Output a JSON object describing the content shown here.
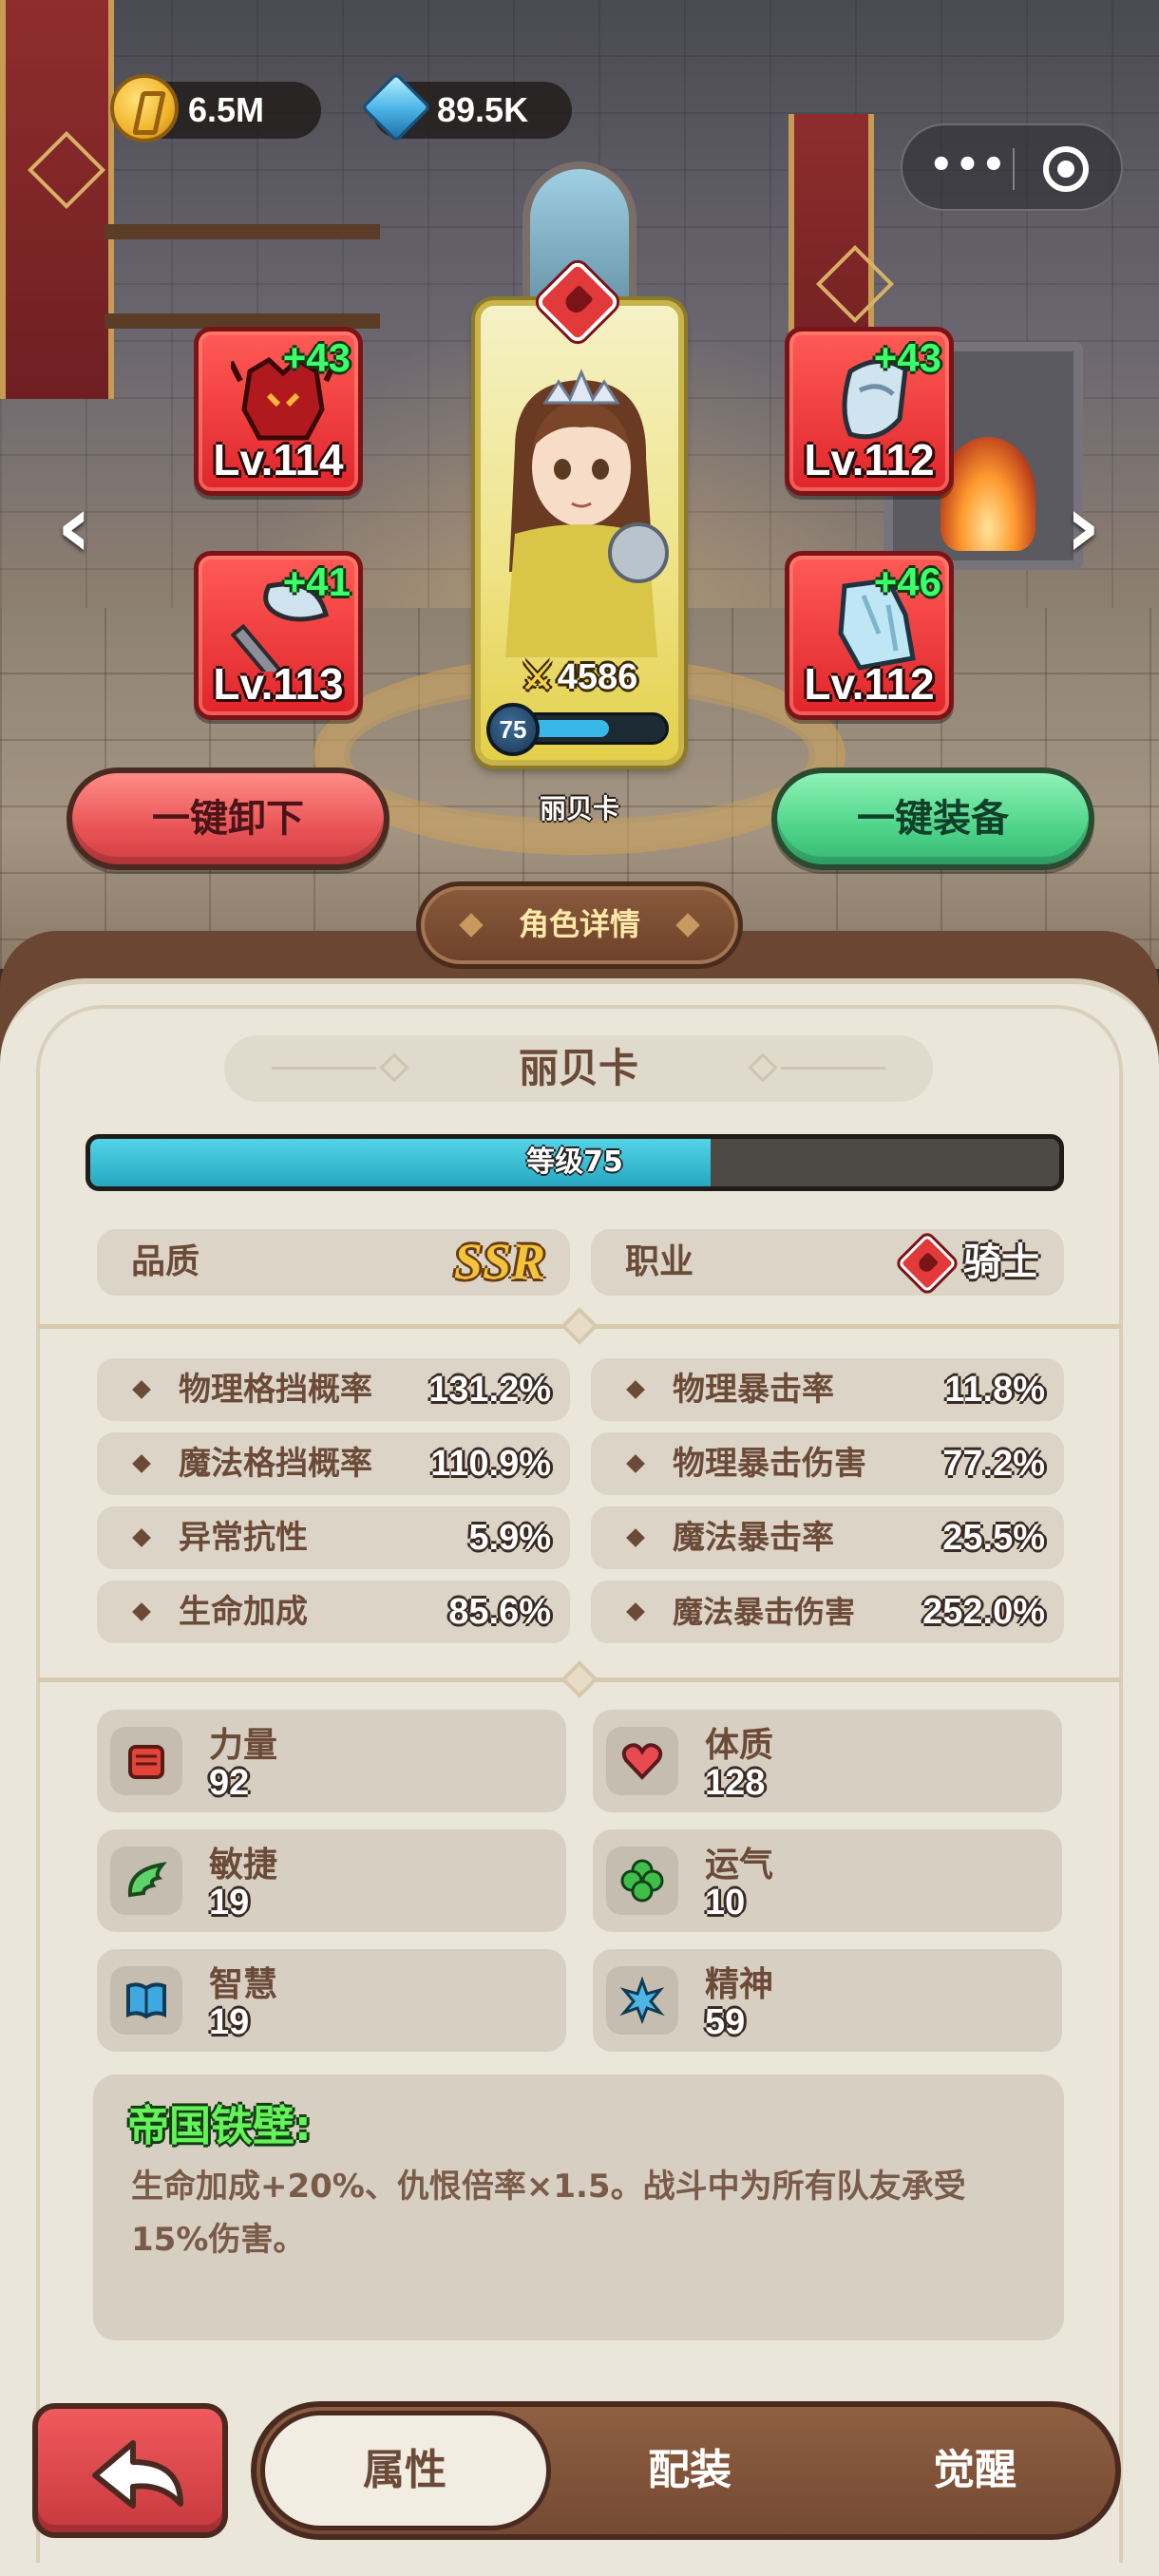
{
  "hud": {
    "gold": "6.5M",
    "gems": "89.5K",
    "gold_icon": "gold-coin-icon",
    "gem_icon": "blue-gem-icon",
    "more_label": "•••"
  },
  "equipment": [
    {
      "slot": "helmet",
      "plus": "+43",
      "level": "Lv.114"
    },
    {
      "slot": "axe",
      "plus": "+41",
      "level": "Lv.113"
    },
    {
      "slot": "armor",
      "plus": "+43",
      "level": "Lv.112"
    },
    {
      "slot": "boots",
      "plus": "+46",
      "level": "Lv.112"
    }
  ],
  "hero_card": {
    "power": "4586",
    "level": "75",
    "xp_fraction": 0.6,
    "name": "丽贝卡"
  },
  "actions": {
    "unequip_all": "一键卸下",
    "equip_all": "一键装备"
  },
  "panel": {
    "title": "角色详情",
    "hero_name": "丽贝卡",
    "level_text": "等级75",
    "level_fraction": 0.64,
    "quality_label": "品质",
    "quality_value": "SSR",
    "class_label": "职业",
    "class_value": "骑士"
  },
  "stats_left": [
    {
      "name": "物理格挡概率",
      "value": "131.2%"
    },
    {
      "name": "魔法格挡概率",
      "value": "110.9%"
    },
    {
      "name": "异常抗性",
      "value": "5.9%"
    },
    {
      "name": "生命加成",
      "value": "85.6%"
    }
  ],
  "stats_right": [
    {
      "name": "物理暴击率",
      "value": "11.8%"
    },
    {
      "name": "物理暴击伤害",
      "value": "77.2%"
    },
    {
      "name": "魔法暴击率",
      "value": "25.5%"
    },
    {
      "name": "魔法暴击伤害",
      "value": "252.0%"
    }
  ],
  "attributes": [
    {
      "name": "力量",
      "value": "92",
      "icon": "fist-icon"
    },
    {
      "name": "体质",
      "value": "128",
      "icon": "heart-icon"
    },
    {
      "name": "敏捷",
      "value": "19",
      "icon": "wing-icon"
    },
    {
      "name": "运气",
      "value": "10",
      "icon": "clover-icon"
    },
    {
      "name": "智慧",
      "value": "19",
      "icon": "book-icon"
    },
    {
      "name": "精神",
      "value": "59",
      "icon": "spirit-star-icon"
    }
  ],
  "skill": {
    "title": "帝国铁壁:",
    "description": "生命加成+20%、仇恨倍率×1.5。战斗中为所有队友承受15%伤害。"
  },
  "tabs": [
    {
      "label": "属性",
      "active": true
    },
    {
      "label": "配装",
      "active": false
    },
    {
      "label": "觉醒",
      "active": false
    }
  ],
  "colors": {
    "slot_red": "#e0252b",
    "unequip_red": "#e95557",
    "equip_green": "#4fd48a",
    "panel_brown": "#6b4632",
    "panel_bg": "#ebe6da",
    "level_cyan": "#27a8c2",
    "ssr_gold": "#f1c43c",
    "skill_green": "#66f25a"
  }
}
